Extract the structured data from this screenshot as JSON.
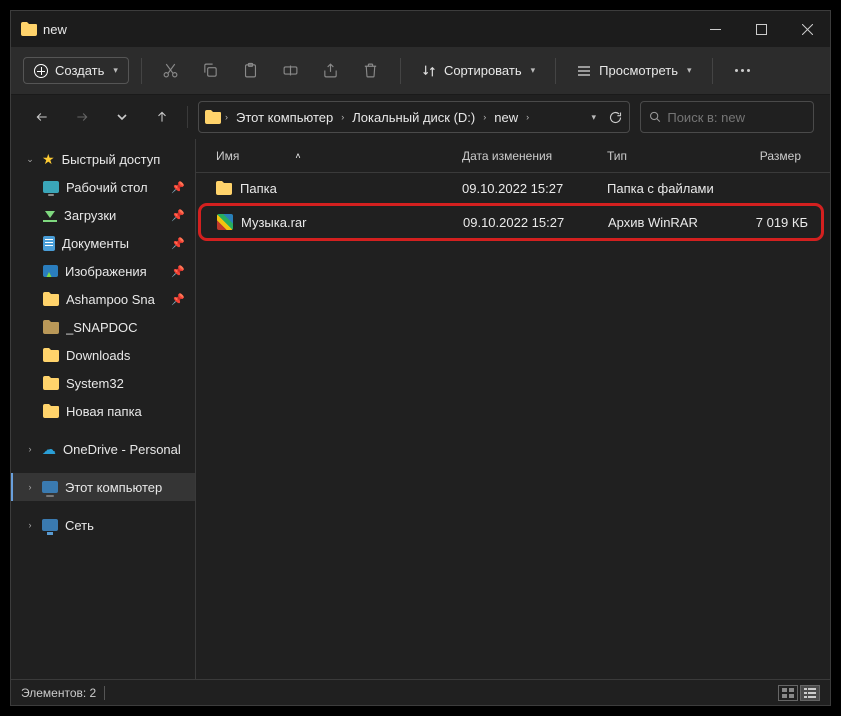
{
  "title": "new",
  "toolbar": {
    "create": "Создать",
    "sort": "Сортировать",
    "view": "Просмотреть"
  },
  "breadcrumbs": [
    "Этот компьютер",
    "Локальный диск (D:)",
    "new"
  ],
  "search": {
    "placeholder": "Поиск в: new"
  },
  "sidebar": {
    "quick_access": "Быстрый доступ",
    "items": [
      {
        "label": "Рабочий стол",
        "pinned": true
      },
      {
        "label": "Загрузки",
        "pinned": true
      },
      {
        "label": "Документы",
        "pinned": true
      },
      {
        "label": "Изображения",
        "pinned": true
      },
      {
        "label": "Ashampoo Sna",
        "pinned": true
      },
      {
        "label": "_SNAPDOC",
        "pinned": false
      },
      {
        "label": "Downloads",
        "pinned": false
      },
      {
        "label": "System32",
        "pinned": false
      },
      {
        "label": "Новая папка",
        "pinned": false
      }
    ],
    "onedrive": "OneDrive - Personal",
    "this_pc": "Этот компьютер",
    "network": "Сеть"
  },
  "columns": {
    "name": "Имя",
    "date": "Дата изменения",
    "type": "Тип",
    "size": "Размер"
  },
  "files": [
    {
      "name": "Папка",
      "date": "09.10.2022 15:27",
      "type": "Папка с файлами",
      "size": ""
    },
    {
      "name": "Музыка.rar",
      "date": "09.10.2022 15:27",
      "type": "Архив WinRAR",
      "size": "7 019 КБ"
    }
  ],
  "status": {
    "elements": "Элементов: 2"
  }
}
